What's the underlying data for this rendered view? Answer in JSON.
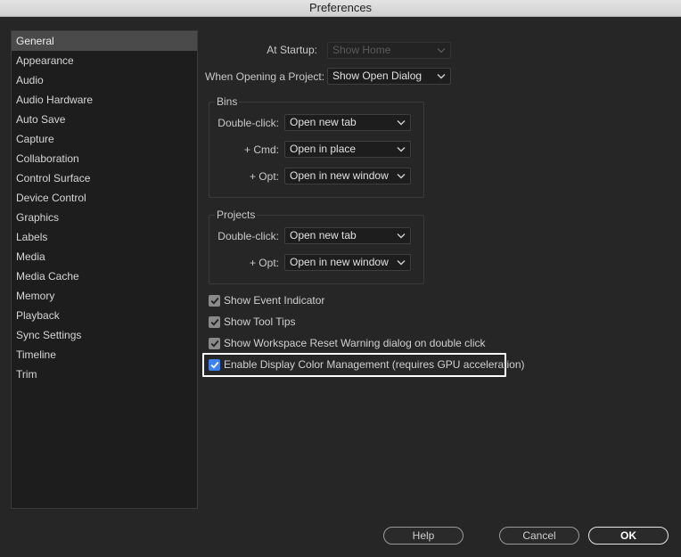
{
  "window": {
    "title": "Preferences"
  },
  "sidebar": {
    "items": [
      {
        "label": "General"
      },
      {
        "label": "Appearance"
      },
      {
        "label": "Audio"
      },
      {
        "label": "Audio Hardware"
      },
      {
        "label": "Auto Save"
      },
      {
        "label": "Capture"
      },
      {
        "label": "Collaboration"
      },
      {
        "label": "Control Surface"
      },
      {
        "label": "Device Control"
      },
      {
        "label": "Graphics"
      },
      {
        "label": "Labels"
      },
      {
        "label": "Media"
      },
      {
        "label": "Media Cache"
      },
      {
        "label": "Memory"
      },
      {
        "label": "Playback"
      },
      {
        "label": "Sync Settings"
      },
      {
        "label": "Timeline"
      },
      {
        "label": "Trim"
      }
    ],
    "selected": "General"
  },
  "general": {
    "at_startup": {
      "label": "At Startup:",
      "value": "Show Home"
    },
    "when_opening": {
      "label": "When Opening a Project:",
      "value": "Show Open Dialog"
    },
    "bins": {
      "title": "Bins",
      "double_click": {
        "label": "Double-click:",
        "value": "Open new tab"
      },
      "cmd": {
        "label": "+ Cmd:",
        "value": "Open in place"
      },
      "opt": {
        "label": "+ Opt:",
        "value": "Open in new window"
      }
    },
    "projects": {
      "title": "Projects",
      "double_click": {
        "label": "Double-click:",
        "value": "Open new tab"
      },
      "opt": {
        "label": "+ Opt:",
        "value": "Open in new window"
      }
    },
    "checkboxes": [
      {
        "label": "Show Event Indicator",
        "checked": true
      },
      {
        "label": "Show Tool Tips",
        "checked": true
      },
      {
        "label": "Show Workspace Reset Warning dialog on double click",
        "checked": true
      },
      {
        "label": "Enable Display Color Management (requires GPU acceleration)",
        "checked": true
      }
    ]
  },
  "buttons": {
    "help": "Help",
    "cancel": "Cancel",
    "ok": "OK"
  },
  "colors": {
    "accent": "#3b82f0",
    "background": "#262626",
    "sidebar_bg": "#1d1d1d",
    "selected_bg": "#4a4a4a"
  }
}
